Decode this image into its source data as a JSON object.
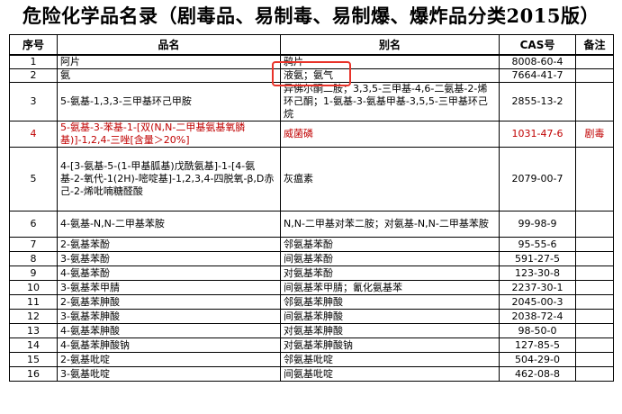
{
  "title": "危险化学品名录（剧毒品、易制毒、易制爆、爆炸品分类2015版）",
  "headers": {
    "seq": "序号",
    "name": "品名",
    "alias": "别名",
    "cas": "CAS号",
    "note": "备注"
  },
  "rows": [
    {
      "seq": "1",
      "name": "阿片",
      "alias": "鸦片",
      "cas": "8008-60-4",
      "note": ""
    },
    {
      "seq": "2",
      "name": "氨",
      "alias": "液氨；氨气",
      "cas": "7664-41-7",
      "note": ""
    },
    {
      "seq": "3",
      "name": "5-氨基-1,3,3-三甲基环己甲胺",
      "alias": "异佛尔酮二胺；3,3,5-三甲基-4,6-二氨基-2-烯环己酮；1-氨基-3-氨基甲基-3,5,5-三甲基环己烷",
      "cas": "2855-13-2",
      "note": ""
    },
    {
      "seq": "4",
      "name": "5-氨基-3-苯基-1-[双(N,N-二甲基氨基氧膦基)]-1,2,4-三唑[含量＞20%]",
      "alias": "威菌磷",
      "cas": "1031-47-6",
      "note": "剧毒",
      "highlight": true
    },
    {
      "seq": "5",
      "name": "4-[3-氨基-5-(1-甲基胍基)戊酰氨基]-1-[4-氨基-2-氧代-1(2H)-嘧啶基]-1,2,3,4-四脱氧-β,D赤己-2-烯吡喃糖醛酸",
      "alias": "灰瘟素",
      "cas": "2079-00-7",
      "note": ""
    },
    {
      "seq": "6",
      "name": "4-氨基-N,N-二甲基苯胺",
      "alias": "N,N-二甲基对苯二胺；对氨基-N,N-二甲基苯胺",
      "cas": "99-98-9",
      "note": ""
    },
    {
      "seq": "7",
      "name": "2-氨基苯酚",
      "alias": "邻氨基苯酚",
      "cas": "95-55-6",
      "note": ""
    },
    {
      "seq": "8",
      "name": "3-氨基苯酚",
      "alias": "间氨基苯酚",
      "cas": "591-27-5",
      "note": ""
    },
    {
      "seq": "9",
      "name": "4-氨基苯酚",
      "alias": "对氨基苯酚",
      "cas": "123-30-8",
      "note": ""
    },
    {
      "seq": "10",
      "name": "3-氨基苯甲腈",
      "alias": "间氨基苯甲腈；氰化氨基苯",
      "cas": "2237-30-1",
      "note": ""
    },
    {
      "seq": "11",
      "name": "2-氨基苯胂酸",
      "alias": "邻氨基苯胂酸",
      "cas": "2045-00-3",
      "note": ""
    },
    {
      "seq": "12",
      "name": "3-氨基苯胂酸",
      "alias": "间氨基苯胂酸",
      "cas": "2038-72-4",
      "note": ""
    },
    {
      "seq": "13",
      "name": "4-氨基苯胂酸",
      "alias": "对氨基苯胂酸",
      "cas": "98-50-0",
      "note": ""
    },
    {
      "seq": "14",
      "name": "4-氨基苯胂酸钠",
      "alias": "对氨基苯胂酸钠",
      "cas": "127-85-5",
      "note": ""
    },
    {
      "seq": "15",
      "name": "2-氨基吡啶",
      "alias": "邻氨基吡啶",
      "cas": "504-29-0",
      "note": ""
    },
    {
      "seq": "16",
      "name": "3-氨基吡啶",
      "alias": "间氨基吡啶",
      "cas": "462-08-8",
      "note": ""
    }
  ],
  "colors": {
    "highlight_text": "#c00000",
    "annotation_box": "#e8332a"
  }
}
